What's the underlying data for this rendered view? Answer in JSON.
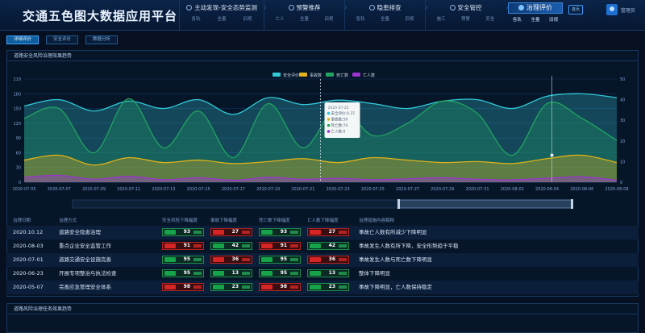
{
  "app": {
    "title": "交通五色图大数据应用平台"
  },
  "nav": [
    {
      "label": "主动发现-安全态势监测",
      "subs": [
        "各轨",
        "全量",
        "旧规"
      ]
    },
    {
      "label": "预警推荐",
      "subs": [
        "亡人",
        "全量",
        "旧规"
      ]
    },
    {
      "label": "隐患排查",
      "subs": [
        "各轨",
        "全量",
        "旧规"
      ]
    },
    {
      "label": "安全管控",
      "subs": [
        "施工",
        "预警",
        "安全"
      ]
    },
    {
      "label": "治理评价",
      "subs": [
        "各轨",
        "全量",
        "旧规"
      ]
    }
  ],
  "home_label": "首页",
  "user_name": "管理员",
  "tabs": [
    "详细评价",
    "安全评价",
    "数据分析"
  ],
  "panel1_title": "道路安全风险治理效果趋势",
  "panel2_title": "道路风险治理任务效果趋势",
  "chart_data": {
    "type": "area",
    "title": "",
    "x": [
      "2020-07-05",
      "2020-07-07",
      "2020-07-09",
      "2020-07-11",
      "2020-07-13",
      "2020-07-15",
      "2020-07-17",
      "2020-07-19",
      "2020-07-21",
      "2020-07-23",
      "2020-07-25",
      "2020-07-27",
      "2020-07-29",
      "2020-07-31",
      "2020-08-02",
      "2020-08-04",
      "2020-08-06",
      "2020-08-08"
    ],
    "y_left_ticks": [
      0,
      30,
      60,
      90,
      120,
      150,
      180,
      210
    ],
    "y_right_ticks": [
      0,
      10,
      20,
      30,
      40,
      50
    ],
    "y_left_range": [
      0,
      210
    ],
    "y_right_range": [
      0,
      50
    ],
    "legend": [
      "安全评价",
      "事故数",
      "死亡数",
      "亡人数"
    ],
    "legend_placement": "top-center",
    "colors": {
      "安全评价": "#31c9d6",
      "事故数": "#e0b31a",
      "死亡数": "#22a362",
      "亡人数": "#9b34d1"
    },
    "series": [
      {
        "name": "安全评价",
        "axis": "left",
        "values": [
          155,
          168,
          145,
          165,
          150,
          168,
          138,
          172,
          158,
          167,
          160,
          150,
          165,
          168,
          150,
          175,
          180,
          172
        ]
      },
      {
        "name": "事故数",
        "axis": "left",
        "values": [
          45,
          55,
          35,
          50,
          40,
          45,
          38,
          42,
          48,
          40,
          50,
          45,
          40,
          42,
          38,
          48,
          55,
          40
        ]
      },
      {
        "name": "死亡数",
        "axis": "left",
        "values": [
          130,
          150,
          60,
          170,
          70,
          145,
          50,
          160,
          70,
          155,
          95,
          120,
          165,
          140,
          55,
          160,
          130,
          85
        ]
      },
      {
        "name": "亡人数",
        "axis": "left",
        "values": [
          10,
          14,
          6,
          12,
          5,
          9,
          4,
          10,
          6,
          8,
          5,
          7,
          9,
          6,
          5,
          8,
          11,
          4
        ]
      }
    ],
    "tooltip": {
      "date": "2020-07-22",
      "items": [
        {
          "name": "安全评价",
          "value": "0.37"
        },
        {
          "name": "事故数",
          "value": "59"
        },
        {
          "name": "死亡数",
          "value": "74"
        },
        {
          "name": "亡人数",
          "value": "0"
        }
      ]
    }
  },
  "table": {
    "headers": [
      "治理日期",
      "治理方式",
      "安全风险下降幅度",
      "事故下降幅度",
      "死亡数下降幅度",
      "亡人数下降幅度",
      "治理措施内容解释"
    ],
    "rows": [
      {
        "date": "2020.10.12",
        "method": "道路安全隐患治理",
        "vals": [
          [
            "93",
            "green"
          ],
          [
            "27",
            "red"
          ],
          [
            "93",
            "green"
          ],
          [
            "27",
            "red"
          ]
        ],
        "desc": "事故亡人数有所减少下降明显"
      },
      {
        "date": "2020-08-03",
        "method": "重点企业安全监管工作",
        "vals": [
          [
            "91",
            "red"
          ],
          [
            "42",
            "green"
          ],
          [
            "91",
            "red"
          ],
          [
            "42",
            "green"
          ]
        ],
        "desc": "事故发生人数有所下降，安全形势趋于平稳"
      },
      {
        "date": "2020-07-01",
        "method": "道路交通安全设施完善",
        "vals": [
          [
            "95",
            "green"
          ],
          [
            "36",
            "red"
          ],
          [
            "95",
            "green"
          ],
          [
            "36",
            "red"
          ]
        ],
        "desc": "事故发生人数与死亡数下降明显"
      },
      {
        "date": "2020-06-23",
        "method": "开展专项整治与执法检查",
        "vals": [
          [
            "95",
            "green"
          ],
          [
            "13",
            "green"
          ],
          [
            "95",
            "green"
          ],
          [
            "13",
            "green"
          ]
        ],
        "desc": "整体下降明显"
      },
      {
        "date": "2020-05-07",
        "method": "完善应急管理安全体系",
        "vals": [
          [
            "98",
            "red"
          ],
          [
            "23",
            "green"
          ],
          [
            "98",
            "red"
          ],
          [
            "23",
            "green"
          ]
        ],
        "desc": "事故下降明显，亡人数保持稳定"
      }
    ]
  }
}
